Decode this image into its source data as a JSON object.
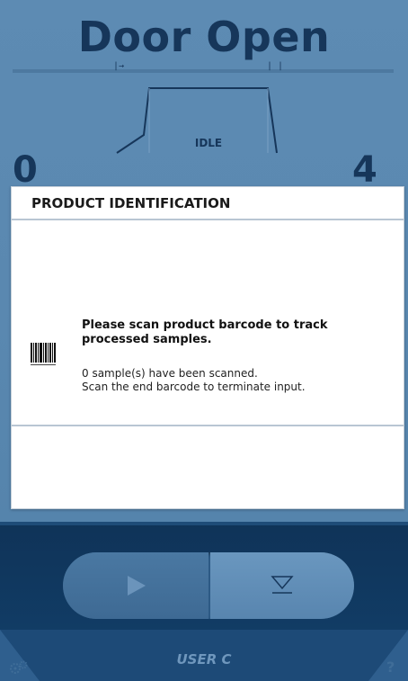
{
  "screen": {
    "title": "Door Open",
    "state_label": "IDLE",
    "count_left": "0",
    "count_right": "4",
    "markers": {
      "start": "|→",
      "end": "| |"
    }
  },
  "dialog": {
    "title": "PRODUCT IDENTIFICATION",
    "icon": "barcode-icon",
    "message_title": "Please scan product barcode to track processed samples.",
    "line1": "0 sample(s) have been scanned.",
    "line2": "Scan the end barcode to terminate input."
  },
  "controls": {
    "start_icon": "play-icon",
    "eject_icon": "eject-icon",
    "user_label": "USER C",
    "help_label": "?",
    "settings_icon": "gears-icon"
  },
  "colors": {
    "screen_bg": "#5a88b0",
    "title": "#16365a",
    "dialog_bg": "#ffffff",
    "controls_bg": "#0f3358",
    "button_start": "#4a78a2",
    "button_eject": "#6a97bf"
  }
}
